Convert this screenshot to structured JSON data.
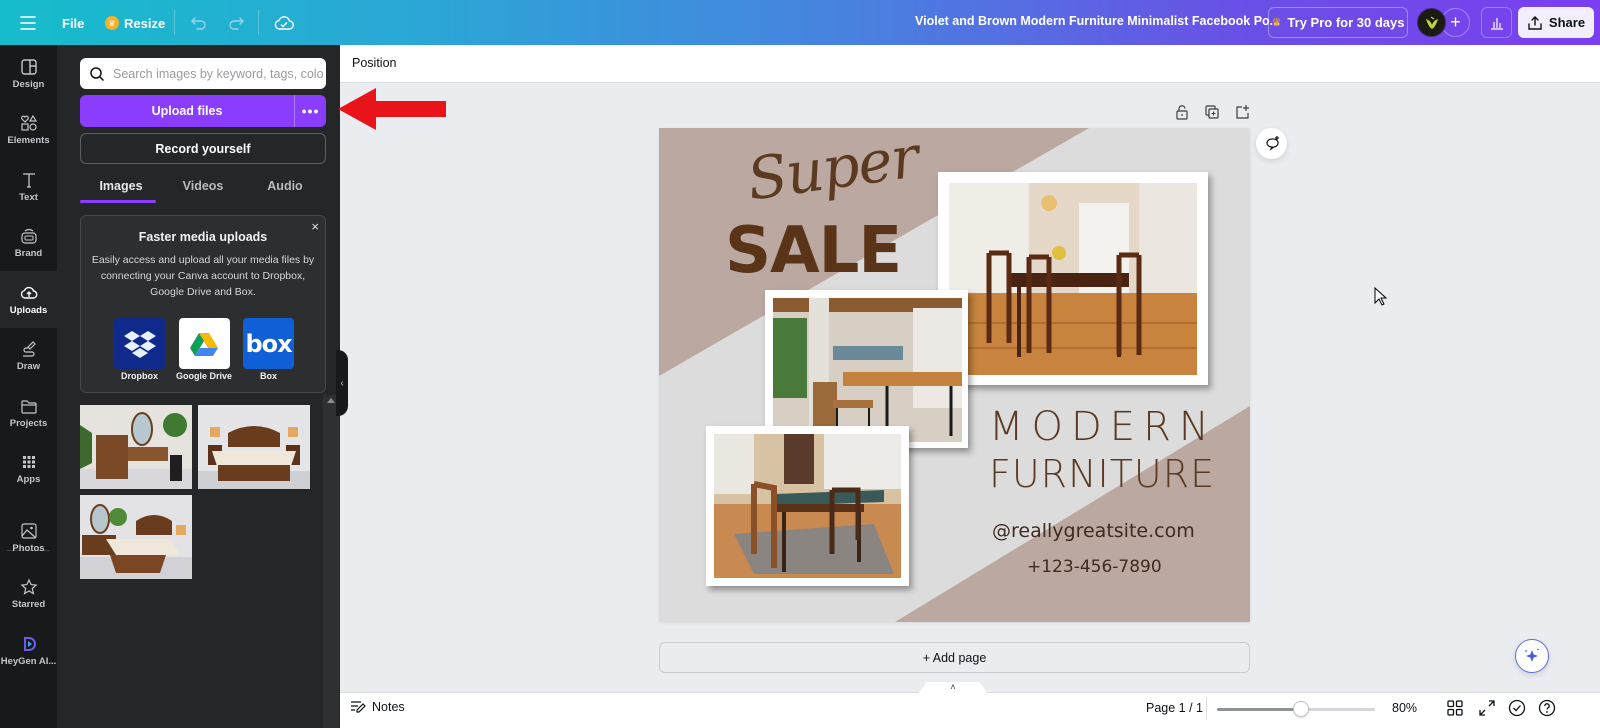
{
  "topbar": {
    "menu_icon": "hamburger-menu-icon",
    "file_label": "File",
    "resize_label": "Resize",
    "doc_title": "Violet and Brown Modern Furniture Minimalist Facebook Po...",
    "try_pro_label": "Try Pro for 30 days",
    "add_collaborator_label": "+",
    "share_label": "Share"
  },
  "rail": {
    "items": [
      {
        "label": "Design",
        "icon": "layout-icon"
      },
      {
        "label": "Elements",
        "icon": "shapes-icon"
      },
      {
        "label": "Text",
        "icon": "text-icon"
      },
      {
        "label": "Brand",
        "icon": "brand-icon"
      },
      {
        "label": "Uploads",
        "icon": "cloud-upload-icon",
        "active": true
      },
      {
        "label": "Draw",
        "icon": "pen-icon"
      },
      {
        "label": "Projects",
        "icon": "folder-icon"
      },
      {
        "label": "Apps",
        "icon": "apps-grid-icon"
      },
      {
        "label": "Photos",
        "icon": "image-icon"
      },
      {
        "label": "Starred",
        "icon": "star-icon"
      },
      {
        "label": "HeyGen AI...",
        "icon": "heygen-logo-icon"
      }
    ]
  },
  "uploads_panel": {
    "search_placeholder": "Search images by keyword, tags, color...",
    "upload_label": "Upload files",
    "more_label": "•••",
    "record_label": "Record yourself",
    "tabs": [
      {
        "label": "Images",
        "active": true
      },
      {
        "label": "Videos"
      },
      {
        "label": "Audio"
      }
    ],
    "promo": {
      "title": "Faster media uploads",
      "text": "Easily access and upload all your media files by connecting your Canva account to Dropbox, Google Drive and Box.",
      "close_label": "×",
      "providers": [
        {
          "label": "Dropbox",
          "color": "#0f2a8a"
        },
        {
          "label": "Google Drive",
          "color": "#ffffff"
        },
        {
          "label": "Box",
          "color": "#0f5fd6"
        }
      ]
    },
    "uploaded_images": [
      {
        "alt": "Bedroom dresser with vanity mirror and plant"
      },
      {
        "alt": "Wooden bed with lamps on nightstands"
      },
      {
        "alt": "Bedroom set with bed, vanity and plant"
      }
    ]
  },
  "context_toolbar": {
    "position_label": "Position"
  },
  "design": {
    "script_text": "Super",
    "headline": "SALE",
    "title_line1": "MODERN",
    "title_line2": "FURNITURE",
    "website": "@reallygreatsite.com",
    "phone": "+123-456-7890",
    "colors": {
      "taupe": "#bba9a1",
      "light_gray": "#dcdcdc",
      "brown": "#5a3418"
    }
  },
  "canvas": {
    "add_page_label": "+ Add page"
  },
  "bottombar": {
    "notes_label": "Notes",
    "page_indicator": "Page 1 / 1",
    "zoom_percent": "80%",
    "zoom_slider_fraction": 0.53
  },
  "accent_color": "#8b3dff"
}
